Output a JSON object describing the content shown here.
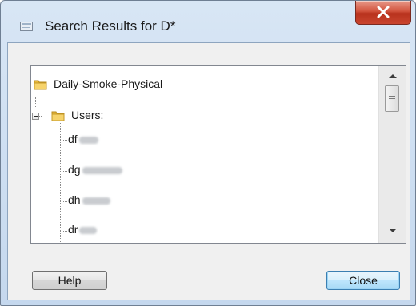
{
  "window": {
    "title": "Search Results for D*"
  },
  "tree": {
    "root": {
      "label": "Daily-Smoke-Physical",
      "icon": "folder-icon"
    },
    "group": {
      "label": "Users:",
      "icon": "folder-icon",
      "expanded": true
    },
    "users": [
      {
        "prefix": "df"
      },
      {
        "prefix": "dg"
      },
      {
        "prefix": "dh"
      },
      {
        "prefix": "dr"
      }
    ]
  },
  "buttons": {
    "help_label": "Help",
    "close_label": "Close"
  },
  "colors": {
    "close_button_red": "#c9452e",
    "default_button_blue": "#a7d9f5",
    "frame_blue": "#c5d8ee"
  }
}
